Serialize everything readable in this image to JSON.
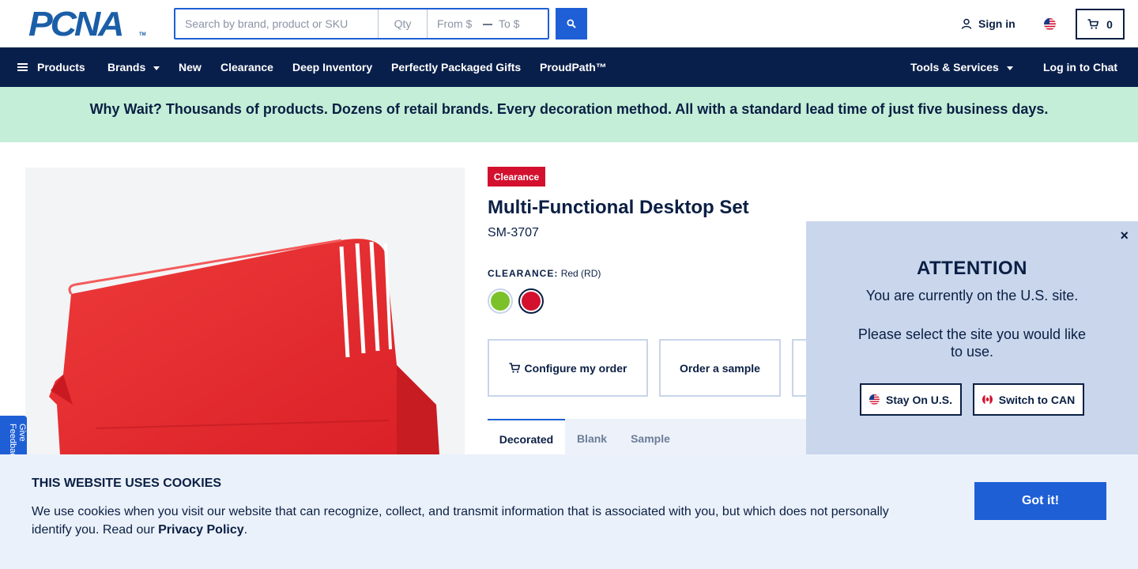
{
  "header": {
    "logo_text": "PCNA",
    "logo_tm": "TM",
    "search_placeholder": "Search by brand, product or SKU",
    "qty_placeholder": "Qty",
    "from_placeholder": "From $",
    "to_placeholder": "To $",
    "sign_in_label": "Sign in",
    "cart_count": "0"
  },
  "nav": {
    "products": "Products",
    "brands": "Brands",
    "new": "New",
    "clearance": "Clearance",
    "deep_inventory": "Deep Inventory",
    "gifts": "Perfectly Packaged Gifts",
    "proudpath": "ProudPath™",
    "tools": "Tools & Services",
    "login_chat": "Log in to Chat"
  },
  "banner": {
    "text": "Why Wait? Thousands of products. Dozens of retail brands. Every decoration method. All with a standard lead time of just five business days."
  },
  "product": {
    "badge": "Clearance",
    "title": "Multi-Functional Desktop Set",
    "sku": "SM-3707",
    "color_label": "CLEARANCE:",
    "color_value": "Red (RD)",
    "swatches": [
      {
        "name": "Lime",
        "color": "#7bc22a"
      },
      {
        "name": "Red",
        "color": "#d3112e"
      }
    ],
    "product_color": "#e8262c",
    "actions": {
      "configure": "Configure my order",
      "sample": "Order a sample"
    },
    "tabs": [
      "Decorated",
      "Blank",
      "Sample"
    ]
  },
  "feedback": {
    "label": "Give Feedback"
  },
  "attention": {
    "close": "×",
    "title": "ATTENTION",
    "line1": "You are currently on the U.S. site.",
    "line2": "Please select the site you would like to use.",
    "stay_label": "Stay On U.S.",
    "switch_label": "Switch to CAN"
  },
  "cookie": {
    "title": "THIS WEBSITE USES COOKIES",
    "text": "We use cookies when you visit our website that can recognize, collect, and transmit information that is associated with you, but which does not personally identify you. Read our",
    "link": "Privacy Policy",
    "period": ".",
    "button": "Got it!"
  },
  "colors": {
    "brand_navy": "#091f4b",
    "brand_blue": "#1f5fd6",
    "banner_green": "#c4eed7",
    "clearance_red": "#d3112e"
  }
}
